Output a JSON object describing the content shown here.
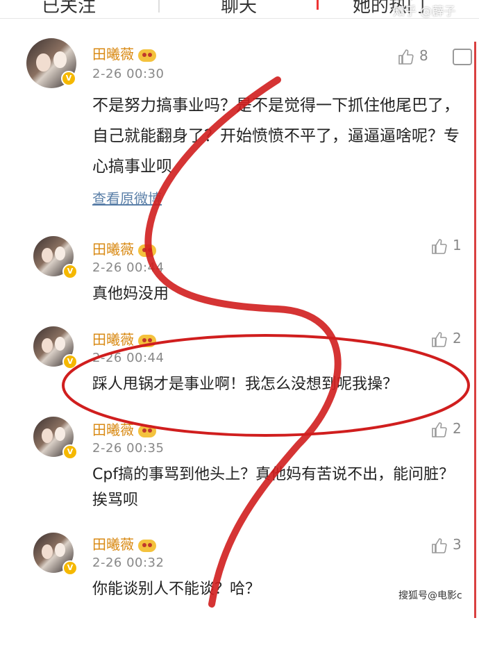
{
  "tabs": [
    {
      "label": "已关注"
    },
    {
      "label": "聊天"
    },
    {
      "label": "她的热门"
    }
  ],
  "watermark_top": "知乎 @薜子",
  "view_original_label": "查看原微博",
  "watermark_bottom": "搜狐号@电影c",
  "comments": [
    {
      "name": "田曦薇",
      "time": "2-26 00:30",
      "text": "不是努力搞事业吗？是不是觉得一下抓住他尾巴了，自己就能翻身了？开始愤愤不平了，逼逼逼啥呢？专心搞事业呗",
      "likes": "8"
    },
    {
      "name": "田曦薇",
      "time": "2-26 00:44",
      "text": "真他妈没用",
      "likes": "1"
    },
    {
      "name": "田曦薇",
      "time": "2-26 00:44",
      "text": "踩人甩锅才是事业啊！我怎么没想到呢我操？",
      "likes": "2"
    },
    {
      "name": "田曦薇",
      "time": "2-26 00:35",
      "text": "Cpf搞的事骂到他头上？真他妈有苦说不出，能问脏？挨骂呗",
      "likes": "2"
    },
    {
      "name": "田曦薇",
      "time": "2-26 00:32",
      "text": "你能谈别人不能谈？哈？",
      "likes": "3"
    }
  ],
  "colors": {
    "name": "#d98a14",
    "annotation": "#d01e1e",
    "link": "#5a7fa8"
  }
}
